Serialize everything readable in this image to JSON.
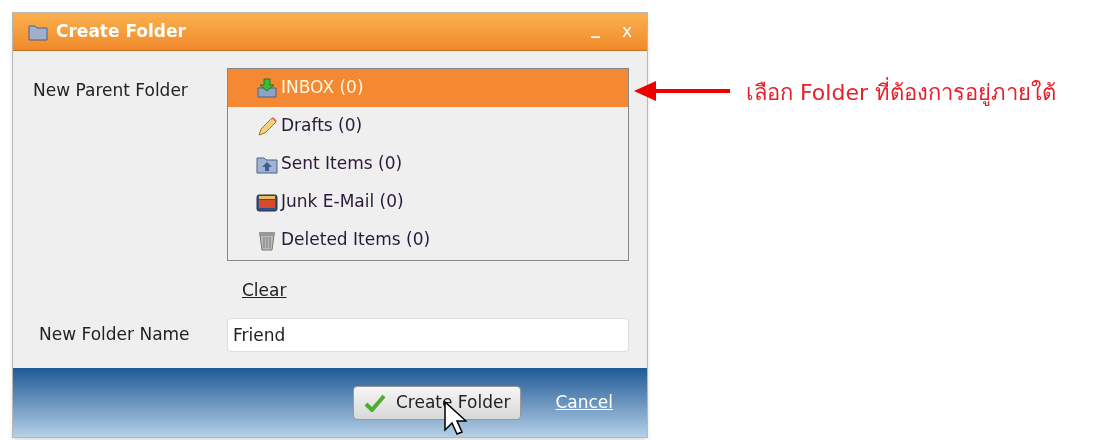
{
  "window": {
    "title": "Create Folder",
    "minimize": "_",
    "close": "x"
  },
  "parent_folder": {
    "label": "New Parent Folder",
    "folders": [
      {
        "kind": "inbox",
        "label": "INBOX (0)",
        "selected": true
      },
      {
        "kind": "drafts",
        "label": "Drafts (0)",
        "selected": false
      },
      {
        "kind": "sent",
        "label": "Sent Items (0)",
        "selected": false
      },
      {
        "kind": "junk",
        "label": "Junk E-Mail (0)",
        "selected": false
      },
      {
        "kind": "deleted",
        "label": "Deleted Items (0)",
        "selected": false
      }
    ],
    "clear": "Clear"
  },
  "folder_name": {
    "label": "New Folder Name",
    "value": "Friend"
  },
  "buttons": {
    "create": "Create Folder",
    "cancel": "Cancel"
  },
  "annotation": "เลือก Folder ที่ต้องการอยู่ภายใต้"
}
